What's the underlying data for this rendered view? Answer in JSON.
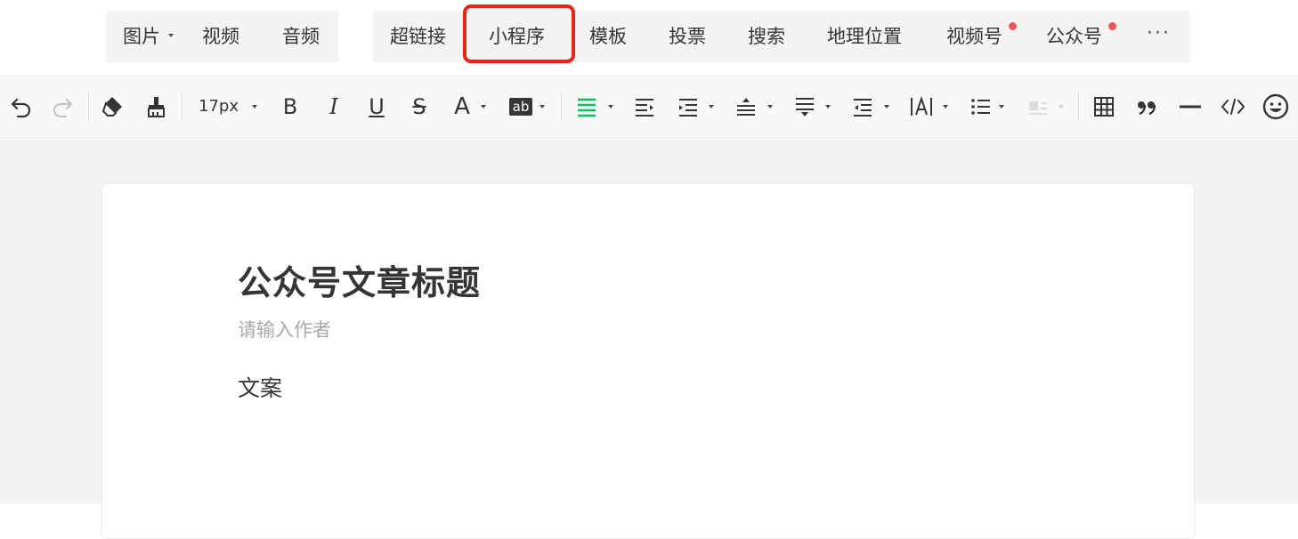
{
  "insert_bar": {
    "media_group": [
      {
        "label": "图片",
        "has_dropdown": true
      },
      {
        "label": "视频"
      },
      {
        "label": "音频"
      }
    ],
    "feature_group": [
      {
        "label": "超链接"
      },
      {
        "label": "小程序",
        "highlighted": true
      },
      {
        "label": "模板"
      },
      {
        "label": "投票"
      },
      {
        "label": "搜索"
      },
      {
        "label": "地理位置"
      },
      {
        "label": "视频号",
        "has_new_dot": true
      },
      {
        "label": "公众号",
        "has_new_dot": true
      }
    ],
    "more_label": "···",
    "highlight_color": "#e8231b",
    "new_dot_color": "#f25454"
  },
  "format_toolbar": {
    "font_size": "17px",
    "bold_label": "B",
    "italic_label": "I",
    "underline_label": "U",
    "strike_label": "S",
    "font_color_label": "A",
    "bg_color_label": "ab",
    "icons": [
      "undo-icon",
      "redo-icon",
      "format-eraser-icon",
      "format-brush-icon",
      "font-size-dropdown",
      "bold-icon",
      "italic-icon",
      "underline-icon",
      "strikethrough-icon",
      "font-color-icon",
      "background-color-icon",
      "align-icon",
      "indent-first-line-icon",
      "indent-icon",
      "line-height-icon",
      "paragraph-spacing-icon",
      "outdent-icon",
      "letter-spacing-icon",
      "list-icon",
      "disabled-float-icon",
      "table-icon",
      "quote-icon",
      "divider-icon",
      "code-icon",
      "emoji-icon"
    ],
    "active_color": "#07c160"
  },
  "editor": {
    "title": "公众号文章标题",
    "author_placeholder": "请输入作者",
    "body": "文案"
  }
}
